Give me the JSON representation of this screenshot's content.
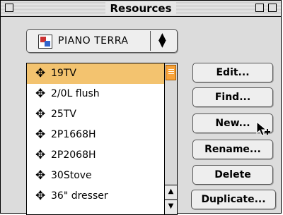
{
  "window": {
    "title": "Resources"
  },
  "popup": {
    "selected": "PIANO TERRA",
    "icon": "document-icon",
    "arrows": "updown-arrows-icon"
  },
  "list": {
    "items": [
      {
        "label": "19TV",
        "selected": true
      },
      {
        "label": "2/0L flush",
        "selected": false
      },
      {
        "label": "25TV",
        "selected": false
      },
      {
        "label": "2P1668H",
        "selected": false
      },
      {
        "label": "2P2068H",
        "selected": false
      },
      {
        "label": "30Stove",
        "selected": false
      },
      {
        "label": "36\" dresser",
        "selected": false
      }
    ],
    "item_icon": "object-resource-icon"
  },
  "buttons": {
    "edit": "Edit...",
    "find": "Find...",
    "new": "New...",
    "rename": "Rename...",
    "delete": "Delete",
    "duplicate": "Duplicate..."
  },
  "colors": {
    "selection": "#f3c36f",
    "scroll_thumb": "#f7a23a"
  }
}
